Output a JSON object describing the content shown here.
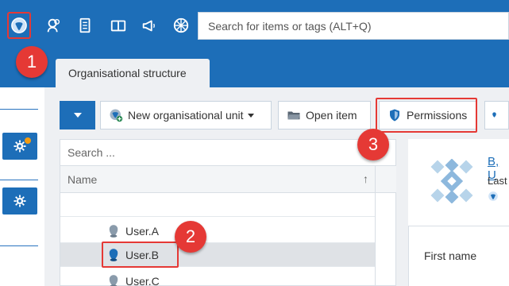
{
  "topbar": {
    "icons": [
      "org-structure-icon",
      "users-icon",
      "document-icon",
      "book-icon",
      "megaphone-icon",
      "snowflake-icon"
    ],
    "search_placeholder": "Search for items or tags (ALT+Q)"
  },
  "tabs": [
    {
      "label": "Organisational structure"
    }
  ],
  "toolbar": {
    "new_unit_label": "New organisational unit",
    "open_item_label": "Open item",
    "permissions_label": "Permissions"
  },
  "list": {
    "search_placeholder": "Search ...",
    "column_name": "Name",
    "sort_glyph": "↑",
    "rows": [
      {
        "label": ""
      },
      {
        "label": "User.A"
      },
      {
        "label": "User.B"
      },
      {
        "label": "User.C"
      }
    ]
  },
  "detail": {
    "name": "B, U",
    "sub": "Last",
    "field_first_name": "First name"
  },
  "callouts": [
    "1",
    "2",
    "3"
  ],
  "colors": {
    "brand_blue": "#1d6eb8",
    "highlight_red": "#e53935",
    "notification_orange": "#f39c12"
  }
}
